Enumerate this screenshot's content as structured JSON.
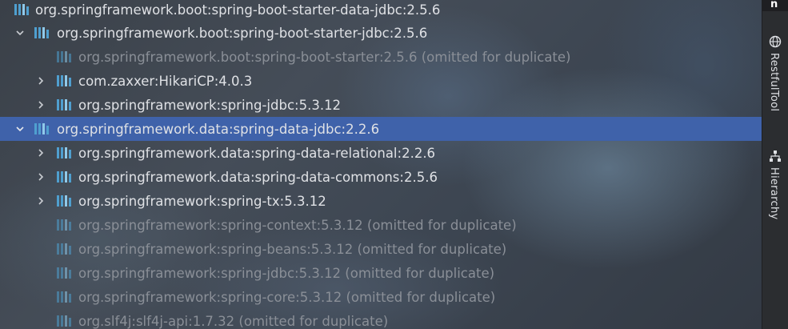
{
  "tree": {
    "rows": [
      {
        "label": "org.springframework.boot:spring-boot-starter-data-jdbc:2.5.6",
        "expanded": true,
        "dim": false,
        "selected": false
      },
      {
        "label": "org.springframework.boot:spring-boot-starter-jdbc:2.5.6",
        "expanded": true,
        "dim": false,
        "selected": false
      },
      {
        "label": "org.springframework.boot:spring-boot-starter:2.5.6 (omitted for duplicate)",
        "expanded": null,
        "dim": true,
        "selected": false
      },
      {
        "label": "com.zaxxer:HikariCP:4.0.3",
        "expanded": false,
        "dim": false,
        "selected": false
      },
      {
        "label": "org.springframework:spring-jdbc:5.3.12",
        "expanded": false,
        "dim": false,
        "selected": false
      },
      {
        "label": "org.springframework.data:spring-data-jdbc:2.2.6",
        "expanded": true,
        "dim": false,
        "selected": true
      },
      {
        "label": "org.springframework.data:spring-data-relational:2.2.6",
        "expanded": false,
        "dim": false,
        "selected": false
      },
      {
        "label": "org.springframework.data:spring-data-commons:2.5.6",
        "expanded": false,
        "dim": false,
        "selected": false
      },
      {
        "label": "org.springframework:spring-tx:5.3.12",
        "expanded": false,
        "dim": false,
        "selected": false
      },
      {
        "label": "org.springframework:spring-context:5.3.12 (omitted for duplicate)",
        "expanded": null,
        "dim": true,
        "selected": false
      },
      {
        "label": "org.springframework:spring-beans:5.3.12 (omitted for duplicate)",
        "expanded": null,
        "dim": true,
        "selected": false
      },
      {
        "label": "org.springframework:spring-jdbc:5.3.12 (omitted for duplicate)",
        "expanded": null,
        "dim": true,
        "selected": false
      },
      {
        "label": "org.springframework:spring-core:5.3.12 (omitted for duplicate)",
        "expanded": null,
        "dim": true,
        "selected": false
      },
      {
        "label": "org.slf4j:slf4j-api:1.7.32 (omitted for duplicate)",
        "expanded": null,
        "dim": true,
        "selected": false
      }
    ]
  },
  "sidebar": {
    "top_label": "n",
    "restful_tool": {
      "label": "RestfulTool",
      "icon": "globe-icon"
    },
    "hierarchy": {
      "label": "Hierarchy",
      "icon": "hierarchy-icon"
    }
  },
  "colors": {
    "selection": "#3f62aa",
    "text": "#dfe1e5",
    "dim_text": "#8a8f97",
    "library_icon": "#4f9fcf"
  }
}
